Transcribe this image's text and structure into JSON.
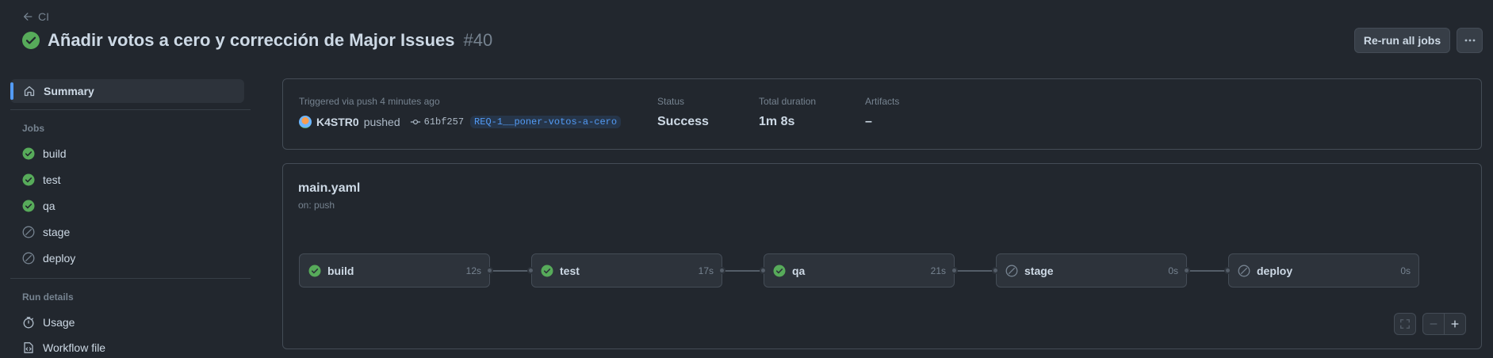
{
  "header": {
    "back_label": "CI",
    "title": "Añadir votos a cero y corrección de Major Issues",
    "run_number": "#40",
    "rerun_label": "Re-run all jobs"
  },
  "sidebar": {
    "summary_label": "Summary",
    "jobs_heading": "Jobs",
    "jobs": [
      {
        "label": "build",
        "status": "success"
      },
      {
        "label": "test",
        "status": "success"
      },
      {
        "label": "qa",
        "status": "success"
      },
      {
        "label": "stage",
        "status": "skipped"
      },
      {
        "label": "deploy",
        "status": "skipped"
      }
    ],
    "run_details_heading": "Run details",
    "usage_label": "Usage",
    "workflow_file_label": "Workflow file"
  },
  "summary": {
    "trigger_text": "Triggered via push 4 minutes ago",
    "actor": "K4STR0",
    "action": "pushed",
    "commit_sha": "61bf257",
    "branch": "REQ-1__poner-votos-a-cero",
    "status_label": "Status",
    "status_value": "Success",
    "duration_label": "Total duration",
    "duration_value": "1m 8s",
    "artifacts_label": "Artifacts",
    "artifacts_value": "–"
  },
  "workflow": {
    "file_name": "main.yaml",
    "trigger": "on: push",
    "jobs": [
      {
        "name": "build",
        "duration": "12s",
        "status": "success"
      },
      {
        "name": "test",
        "duration": "17s",
        "status": "success"
      },
      {
        "name": "qa",
        "duration": "21s",
        "status": "success"
      },
      {
        "name": "stage",
        "duration": "0s",
        "status": "skipped"
      },
      {
        "name": "deploy",
        "duration": "0s",
        "status": "skipped"
      }
    ]
  },
  "colors": {
    "success": "#57ab5a",
    "accent": "#539bf5",
    "background": "#22272e"
  }
}
